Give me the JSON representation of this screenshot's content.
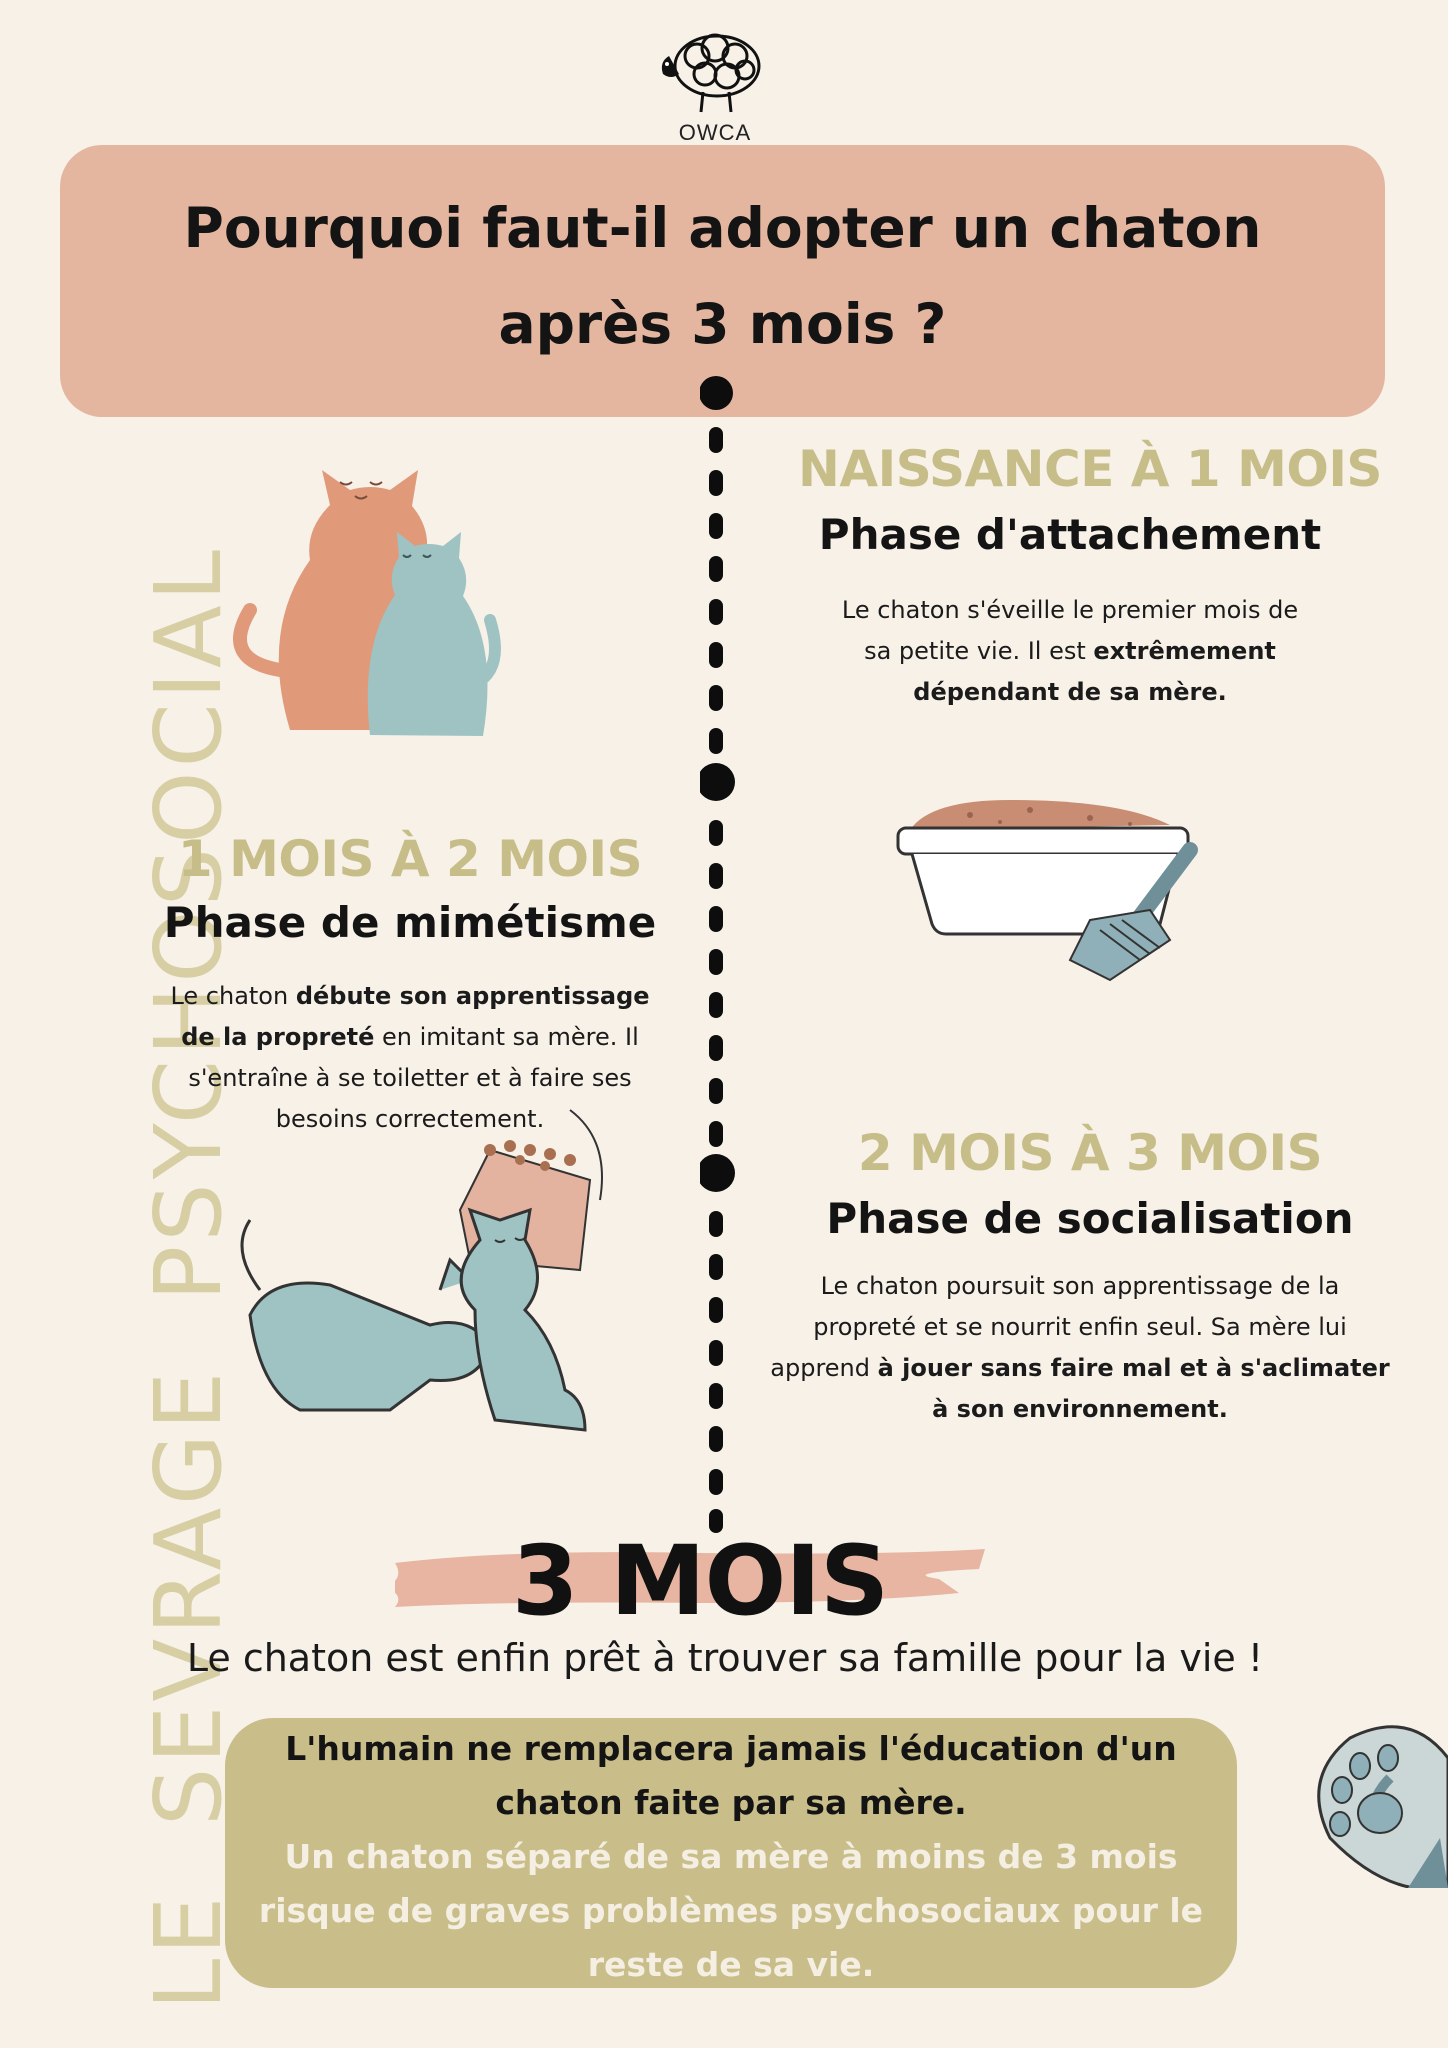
{
  "logo": {
    "label": "OWCA"
  },
  "title": {
    "line1": "Pourquoi faut-il adopter un chaton",
    "line2": "après 3 mois ?"
  },
  "side": {
    "word1": "LE",
    "word2": "SEVRAGE",
    "word3": "PSYCHOSOCIAL"
  },
  "stages": [
    {
      "range": "NAISSANCE À 1 MOIS",
      "phase": "Phase d'attachement",
      "text_a": "Le chaton s'éveille le premier mois de",
      "text_b": "sa petite vie. Il est ",
      "text_bold_b": "extrêmement",
      "text_bold_c": "dépendant de sa mère."
    },
    {
      "range": "1 MOIS À 2 MOIS",
      "phase": "Phase de mimétisme",
      "text_a": "Le chaton ",
      "text_bold_a": "débute son apprentissage",
      "text_bold_b": "de la propreté",
      "text_b": " en imitant sa mère. Il",
      "text_c": "s'entraîne à se toiletter et à faire ses",
      "text_d": "besoins correctement."
    },
    {
      "range": "2 MOIS À 3 MOIS",
      "phase": "Phase de socialisation",
      "text_a": "Le chaton poursuit son apprentissage de la",
      "text_b": "propreté et se nourrit enfin seul. Sa mère lui",
      "text_c": "apprend ",
      "text_bold_c": "à jouer sans faire mal et à s'aclimater",
      "text_bold_d": "à son environnement."
    }
  ],
  "final": {
    "month": "3 MOIS",
    "line": "Le chaton est enfin prêt à trouver sa famille pour la vie !"
  },
  "note": {
    "dark_1": "L'humain ne remplacera jamais l'éducation d'un",
    "dark_2": "chaton faite par sa mère.",
    "light_1": "Un chaton séparé de sa mère à moins de 3 mois",
    "light_2": "risque de graves problèmes psychosociaux pour le",
    "light_3": "reste de sa vie."
  },
  "colors": {
    "background": "#f7f1e8",
    "banner": "#e4b6a0",
    "accent_gold": "#c7bd88",
    "note_box": "#c9be8a",
    "cat_orange": "#e09a7a",
    "cat_blue": "#9fc3c3"
  },
  "icons": [
    "sheep-logo-icon",
    "cats-icon",
    "litter-box-icon",
    "playing-animals-icon",
    "paw-icon"
  ]
}
